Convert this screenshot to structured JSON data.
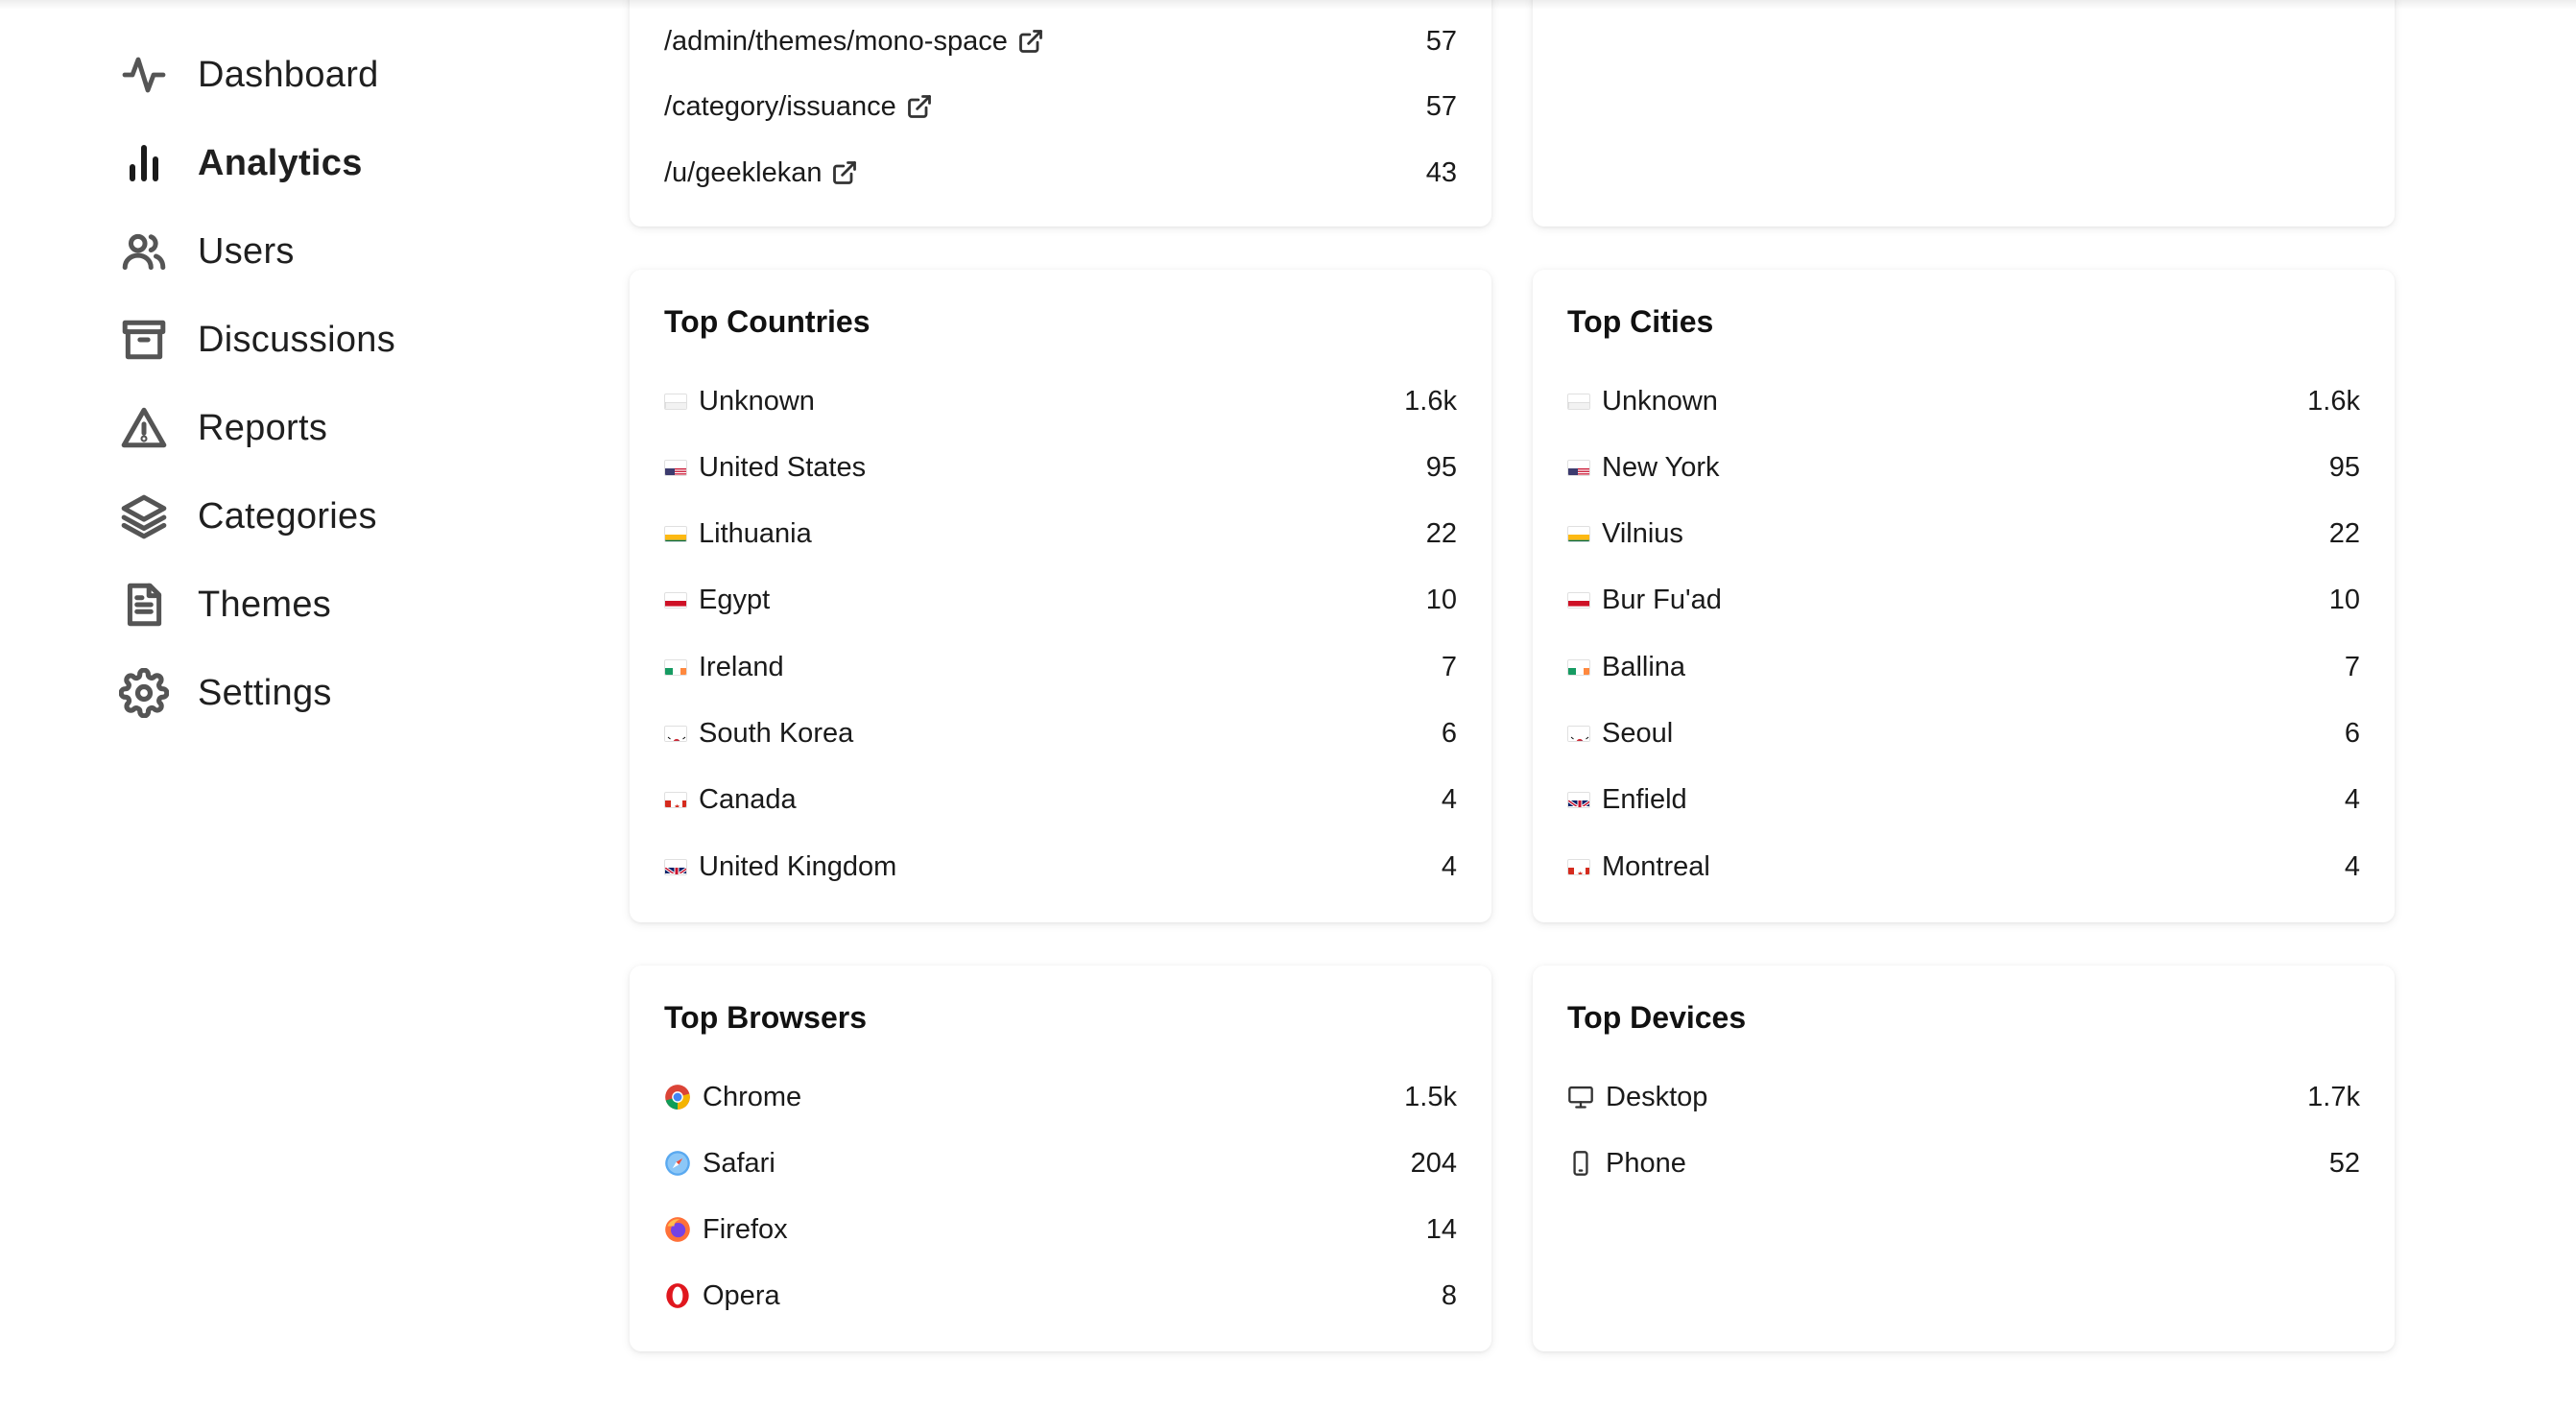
{
  "sidebar": {
    "items": [
      {
        "label": "Dashboard",
        "icon": "activity-icon",
        "active": false
      },
      {
        "label": "Analytics",
        "icon": "bar-chart-icon",
        "active": true
      },
      {
        "label": "Users",
        "icon": "users-icon",
        "active": false
      },
      {
        "label": "Discussions",
        "icon": "archive-box-icon",
        "active": false
      },
      {
        "label": "Reports",
        "icon": "warning-triangle-icon",
        "active": false
      },
      {
        "label": "Categories",
        "icon": "layers-icon",
        "active": false
      },
      {
        "label": "Themes",
        "icon": "document-icon",
        "active": false
      },
      {
        "label": "Settings",
        "icon": "gear-icon",
        "active": false
      }
    ]
  },
  "top_pages": {
    "rows": [
      {
        "path": "/admin/themes/mono-space",
        "count": "57"
      },
      {
        "path": "/category/issuance",
        "count": "57"
      },
      {
        "path": "/u/geeklekan",
        "count": "43"
      }
    ]
  },
  "top_countries": {
    "title": "Top Countries",
    "rows": [
      {
        "flag": "unknown",
        "name": "Unknown",
        "count": "1.6k"
      },
      {
        "flag": "us",
        "name": "United States",
        "count": "95"
      },
      {
        "flag": "lt",
        "name": "Lithuania",
        "count": "22"
      },
      {
        "flag": "eg",
        "name": "Egypt",
        "count": "10"
      },
      {
        "flag": "ie",
        "name": "Ireland",
        "count": "7"
      },
      {
        "flag": "kr",
        "name": "South Korea",
        "count": "6"
      },
      {
        "flag": "ca",
        "name": "Canada",
        "count": "4"
      },
      {
        "flag": "gb",
        "name": "United Kingdom",
        "count": "4"
      }
    ]
  },
  "top_cities": {
    "title": "Top Cities",
    "rows": [
      {
        "flag": "unknown",
        "name": "Unknown",
        "count": "1.6k"
      },
      {
        "flag": "us",
        "name": "New York",
        "count": "95"
      },
      {
        "flag": "lt",
        "name": "Vilnius",
        "count": "22"
      },
      {
        "flag": "eg",
        "name": "Bur Fu'ad",
        "count": "10"
      },
      {
        "flag": "ie",
        "name": "Ballina",
        "count": "7"
      },
      {
        "flag": "kr",
        "name": "Seoul",
        "count": "6"
      },
      {
        "flag": "gb",
        "name": "Enfield",
        "count": "4"
      },
      {
        "flag": "ca",
        "name": "Montreal",
        "count": "4"
      }
    ]
  },
  "top_browsers": {
    "title": "Top Browsers",
    "rows": [
      {
        "icon": "chrome-icon",
        "name": "Chrome",
        "count": "1.5k"
      },
      {
        "icon": "safari-icon",
        "name": "Safari",
        "count": "204"
      },
      {
        "icon": "firefox-icon",
        "name": "Firefox",
        "count": "14"
      },
      {
        "icon": "opera-icon",
        "name": "Opera",
        "count": "8"
      }
    ]
  },
  "top_devices": {
    "title": "Top Devices",
    "rows": [
      {
        "icon": "desktop-icon",
        "name": "Desktop",
        "count": "1.7k"
      },
      {
        "icon": "phone-icon",
        "name": "Phone",
        "count": "52"
      }
    ]
  }
}
